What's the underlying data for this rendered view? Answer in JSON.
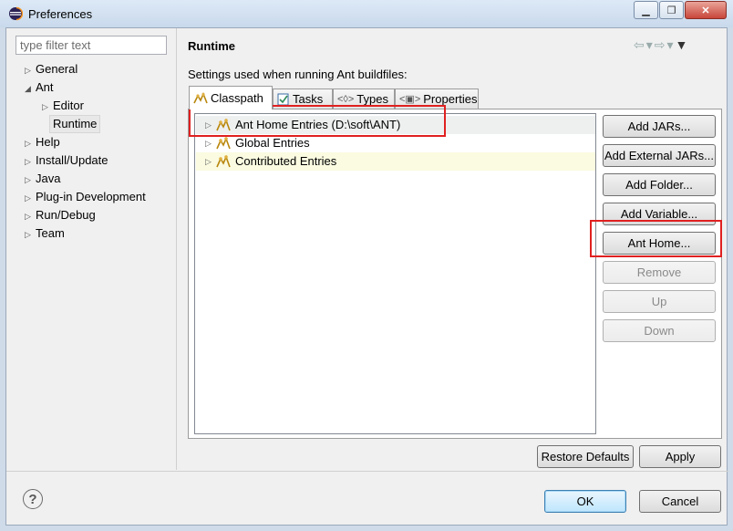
{
  "window": {
    "title": "Preferences",
    "icon": "eclipse-icon",
    "controls": [
      "minimize",
      "maximize",
      "close"
    ]
  },
  "filter": {
    "placeholder": "type filter text"
  },
  "nav": {
    "items": [
      {
        "label": "General",
        "expanded": false
      },
      {
        "label": "Ant",
        "expanded": true
      },
      {
        "label": "Editor",
        "expanded": false
      },
      {
        "label": "Runtime",
        "selected": true
      },
      {
        "label": "Help",
        "expanded": false
      },
      {
        "label": "Install/Update",
        "expanded": false
      },
      {
        "label": "Java",
        "expanded": false
      },
      {
        "label": "Plug-in Development",
        "expanded": false
      },
      {
        "label": "Run/Debug",
        "expanded": false
      },
      {
        "label": "Team",
        "expanded": false
      }
    ]
  },
  "page": {
    "title": "Runtime",
    "subtitle": "Settings used when running Ant buildfiles:"
  },
  "tabs": [
    {
      "label": "Classpath",
      "active": true,
      "icon": "classpath-icon"
    },
    {
      "label": "Tasks",
      "icon": "tasks-icon"
    },
    {
      "label": "Types",
      "icon": "types-icon"
    },
    {
      "label": "Properties",
      "icon": "properties-icon"
    }
  ],
  "classpath": {
    "entries": [
      {
        "label": "Ant Home Entries (D:\\soft\\ANT)"
      },
      {
        "label": "Global Entries"
      },
      {
        "label": "Contributed Entries"
      }
    ]
  },
  "buttons": {
    "add_jars": "Add JARs...",
    "add_external_jars": "Add External JARs...",
    "add_folder": "Add Folder...",
    "add_variable": "Add Variable...",
    "ant_home": "Ant Home...",
    "remove": "Remove",
    "up": "Up",
    "down": "Down",
    "restore_defaults": "Restore Defaults",
    "apply": "Apply",
    "ok": "OK",
    "cancel": "Cancel"
  },
  "colors": {
    "highlight_red": "#e02020",
    "title_bar": "#cfdbe8",
    "row_hover": "#fafbe0"
  }
}
